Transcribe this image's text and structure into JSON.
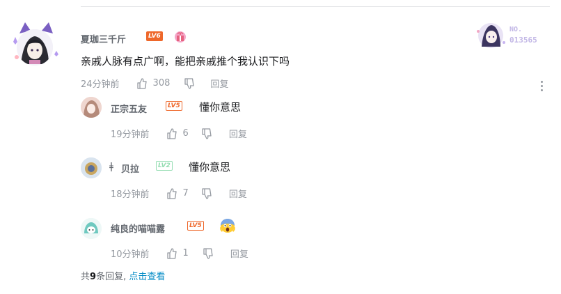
{
  "main_comment": {
    "username": "夏珈三千斤",
    "level": "LV6",
    "text": "亲戚人脉有点广啊，能把亲戚推个我认识下吗",
    "time": "24分钟前",
    "likes": "308",
    "reply_label": "回复",
    "fan_badge_no": "NO.",
    "fan_badge_num": "013565"
  },
  "replies": [
    {
      "username": "正宗五友",
      "level": "LV5",
      "text": "懂你意思",
      "time": "19分钟前",
      "likes": "6",
      "reply_label": "回复"
    },
    {
      "username": "贝拉",
      "level": "LV2",
      "text": "懂你意思",
      "time": "18分钟前",
      "likes": "7",
      "reply_label": "回复"
    },
    {
      "username": "纯良的喵喵露",
      "level": "LV5",
      "text": "😱",
      "time": "10分钟前",
      "likes": "1",
      "reply_label": "回复"
    }
  ],
  "footer": {
    "prefix": "共",
    "count": "9",
    "suffix": "条回复,",
    "link": "点击查看"
  },
  "colors": {
    "accent_link": "#008ac5",
    "lv_orange": "#ee672a",
    "lv_green": "#95ddb2",
    "meta_gray": "#9499a0"
  }
}
